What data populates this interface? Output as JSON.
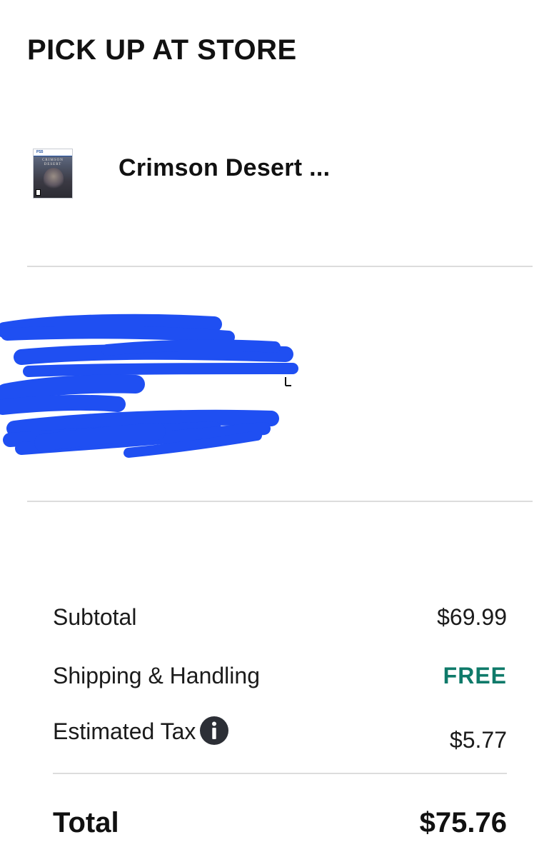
{
  "section": {
    "title": "PICK UP AT STORE"
  },
  "product": {
    "name": "Crimson Desert ...",
    "thumbnail_icon": "product-thumbnail-icon",
    "thumbnail_platform": "PS5",
    "thumbnail_title": "CRIMSON DESERT"
  },
  "summary": {
    "subtotal_label": "Subtotal",
    "subtotal_value": "$69.99",
    "shipping_label": "Shipping & Handling",
    "shipping_value": "FREE",
    "tax_label": "Estimated Tax",
    "tax_info_icon": "info-icon",
    "tax_value": "$5.77",
    "total_label": "Total",
    "total_value": "$75.76"
  },
  "colors": {
    "free_accent": "#0f7a6a",
    "redaction": "#1f4ff2",
    "divider": "#dcdcdc"
  }
}
